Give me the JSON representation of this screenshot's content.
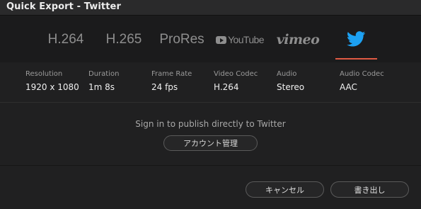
{
  "window": {
    "title": "Quick Export - Twitter"
  },
  "tabs": [
    {
      "id": "h264",
      "label": "H.264"
    },
    {
      "id": "h265",
      "label": "H.265"
    },
    {
      "id": "prores",
      "label": "ProRes"
    },
    {
      "id": "youtube",
      "label": "YouTube",
      "icon": "youtube-icon"
    },
    {
      "id": "vimeo",
      "label": "vimeo"
    },
    {
      "id": "twitter",
      "icon": "twitter-icon",
      "selected": true
    }
  ],
  "accent_color": "#e05a43",
  "twitter_color": "#1da1f2",
  "properties": [
    {
      "label": "Resolution",
      "value": "1920 x 1080"
    },
    {
      "label": "Duration",
      "value": "1m 8s"
    },
    {
      "label": "Frame Rate",
      "value": "24 fps"
    },
    {
      "label": "Video Codec",
      "value": "H.264"
    },
    {
      "label": "Audio",
      "value": "Stereo"
    },
    {
      "label": "Audio Codec",
      "value": "AAC"
    }
  ],
  "signin": {
    "message": "Sign in to publish directly to Twitter",
    "account_button": "アカウント管理"
  },
  "footer": {
    "cancel_label": "キャンセル",
    "export_label": "書き出し"
  }
}
